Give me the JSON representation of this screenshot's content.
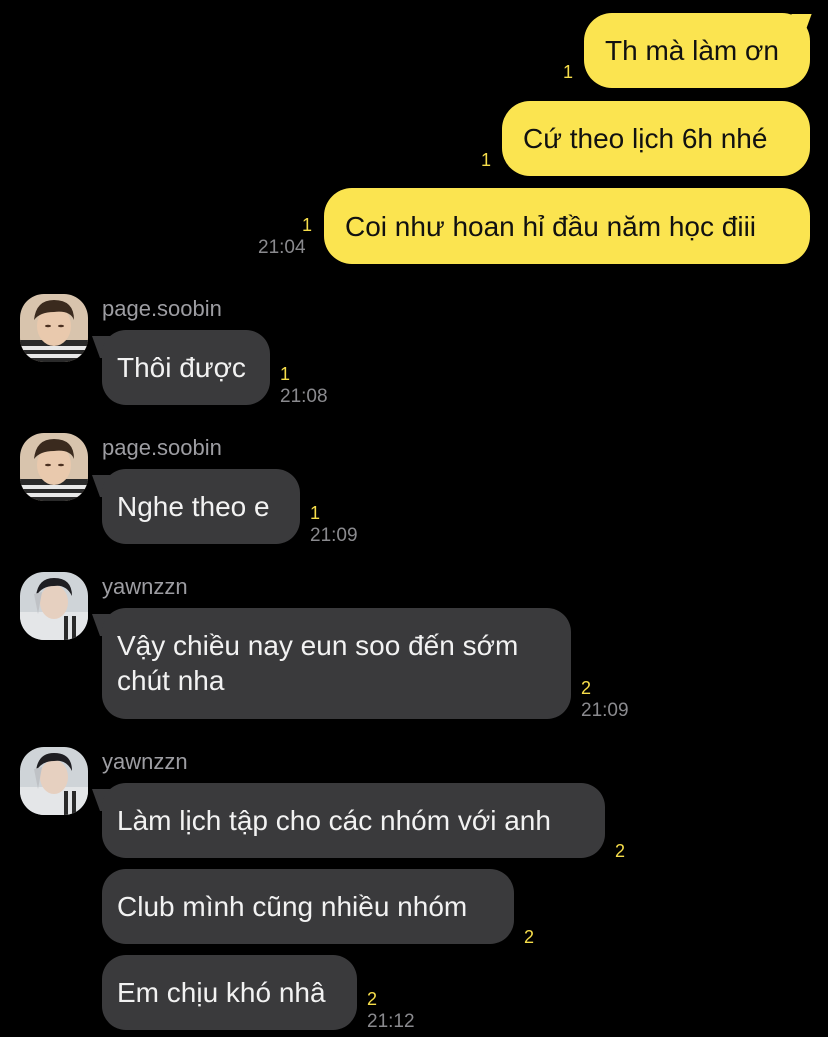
{
  "messages": {
    "m1": {
      "text": "Th mà làm ơn",
      "unread": "1"
    },
    "m2": {
      "text": "Cứ theo lịch 6h nhé",
      "unread": "1"
    },
    "m3": {
      "text": "Coi như hoan hỉ đầu năm học điii",
      "unread": "1",
      "time": "21:04"
    },
    "m4": {
      "sender": "page.soobin",
      "text": "Thôi được",
      "unread": "1",
      "time": "21:08"
    },
    "m5": {
      "sender": "page.soobin",
      "text": "Nghe theo e",
      "unread": "1",
      "time": "21:09"
    },
    "m6": {
      "sender": "yawnzzn",
      "line1": "Vậy chiều nay eun soo đến sớm",
      "line2": "chút nha",
      "unread": "2",
      "time": "21:09"
    },
    "m7": {
      "sender": "yawnzzn",
      "text": "Làm lịch tập cho các nhóm với anh",
      "unread": "2"
    },
    "m8": {
      "text": "Club mình cũng nhiều nhóm",
      "unread": "2"
    },
    "m9": {
      "text": "Em chịu khó nhâ",
      "unread": "2",
      "time": "21:12"
    }
  },
  "colors": {
    "outgoing_bubble": "#fbe450",
    "incoming_bubble": "#3a3a3c",
    "unread_count": "#f6dd4a",
    "background": "#000000"
  },
  "icons": {
    "avatar_soobin": "person-avatar",
    "avatar_yawnzzn": "person-avatar"
  }
}
